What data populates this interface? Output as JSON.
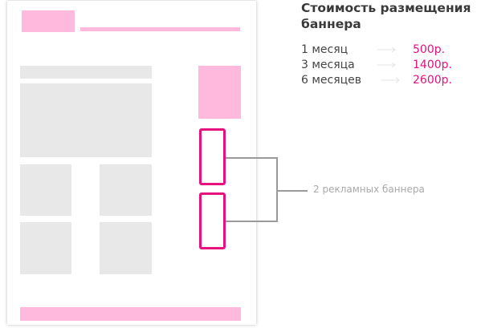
{
  "pricing": {
    "title": "Стоимость размещения баннера",
    "rows": [
      {
        "period": "1 месяц",
        "price": "500р."
      },
      {
        "period": "3 месяца",
        "price": "1400р."
      },
      {
        "period": "6 месяцев",
        "price": "2600р."
      }
    ]
  },
  "annotation": {
    "label": "2 рекламных баннера"
  },
  "colors": {
    "accent": "#e5127d",
    "accent_light": "#ffb9dc",
    "placeholder_gray": "#e8e8e8",
    "connector": "#9a9a9a"
  }
}
